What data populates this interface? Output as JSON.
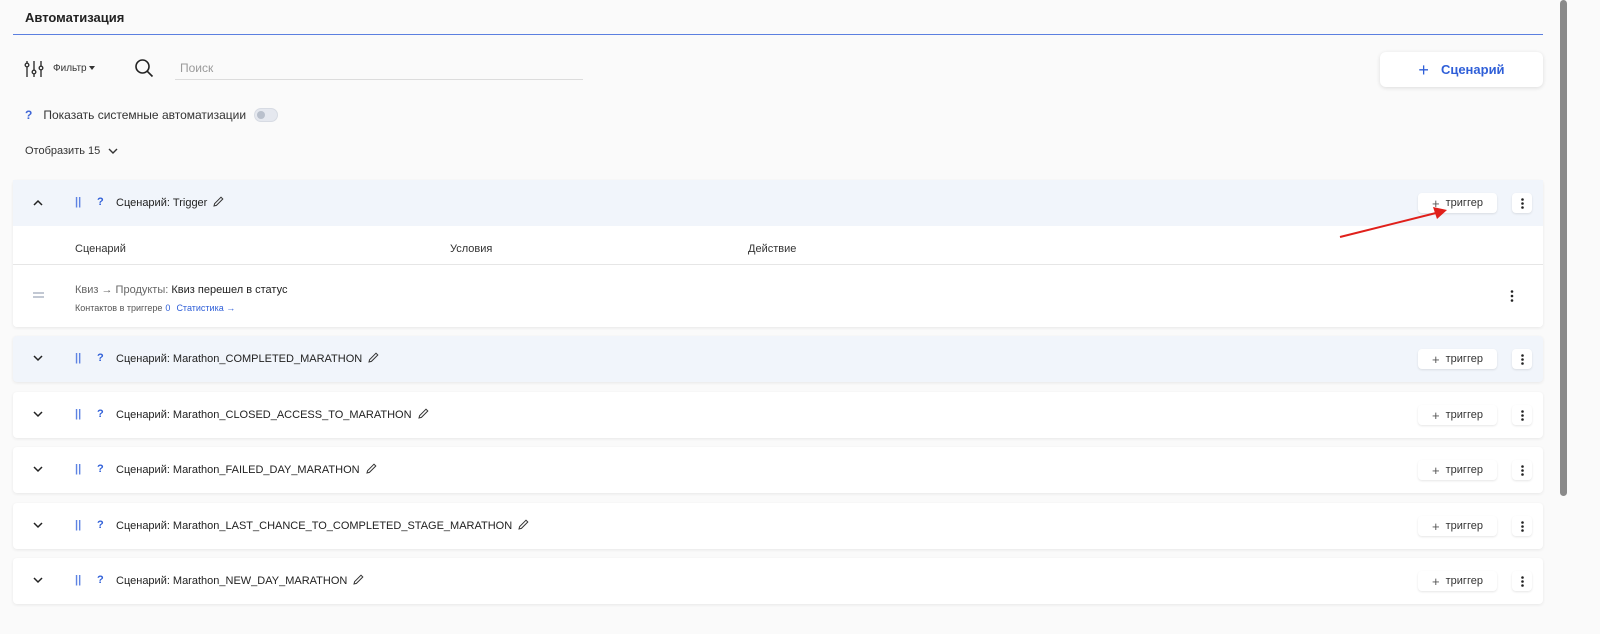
{
  "page": {
    "title": "Автоматизация"
  },
  "toolbar": {
    "filter_label": "Фильтр",
    "search_placeholder": "Поиск",
    "search_value": "",
    "add_scenario_label": "Сценарий"
  },
  "system": {
    "help": "?",
    "label": "Показать системные автоматизации",
    "toggle_on": false
  },
  "show": {
    "label": "Отобразить 15"
  },
  "scenario_prefix": "Сценарий:",
  "trigger_button_label": "триггер",
  "scenarios": [
    {
      "name": "Trigger",
      "expanded": true
    },
    {
      "name": "Marathon_COMPLETED_MARATHON",
      "expanded": false
    },
    {
      "name": "Marathon_CLOSED_ACCESS_TO_MARATHON",
      "expanded": false
    },
    {
      "name": "Marathon_FAILED_DAY_MARATHON",
      "expanded": false
    },
    {
      "name": "Marathon_LAST_CHANCE_TO_COMPLETED_STAGE_MARATHON",
      "expanded": false
    },
    {
      "name": "Marathon_NEW_DAY_MARATHON",
      "expanded": false
    }
  ],
  "columns": {
    "scenario": "Сценарий",
    "conditions": "Условия",
    "action": "Действие"
  },
  "trigger": {
    "source": "Квиз → Продукты:",
    "event": "Квиз перешел в статус",
    "contacts_label": "Контактов в триггере",
    "contacts_count": "0",
    "stats_link": "Статистика →"
  },
  "colors": {
    "accent": "#2f5fd8",
    "annotation_arrow": "#e0201b"
  }
}
